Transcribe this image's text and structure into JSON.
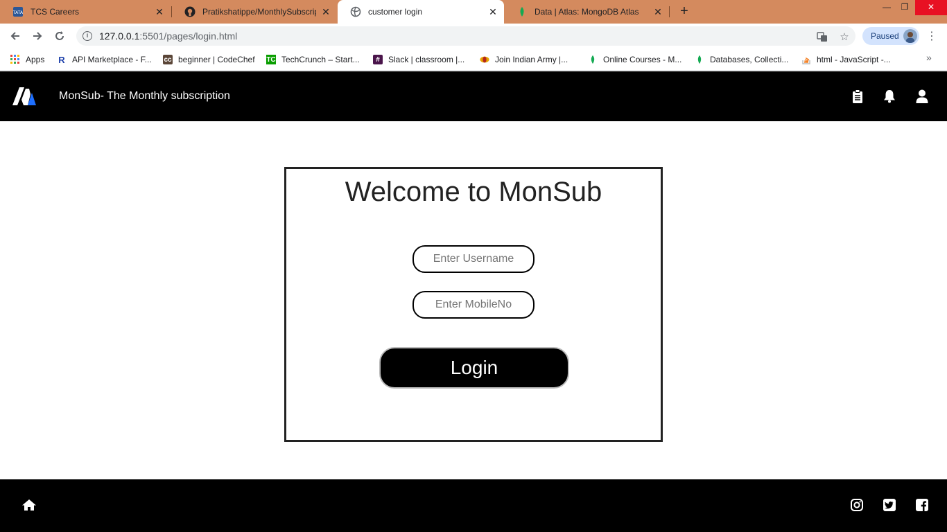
{
  "browser": {
    "tabs": [
      {
        "title": "TCS Careers",
        "favicon": "tata-icon"
      },
      {
        "title": "Pratikshatippe/MonthlySubscript",
        "favicon": "github-icon"
      },
      {
        "title": "customer login",
        "favicon": "globe-icon",
        "active": true
      },
      {
        "title": "Data | Atlas: MongoDB Atlas",
        "favicon": "mongodb-leaf-icon"
      }
    ],
    "url_host": "127.0.0.1",
    "url_path": ":5501/pages/login.html",
    "profile_label": "Paused",
    "bookmarks": [
      {
        "label": "Apps",
        "icon": "apps-grid-icon"
      },
      {
        "label": "API Marketplace - F...",
        "icon": "rapidapi-icon"
      },
      {
        "label": "beginner | CodeChef",
        "icon": "codechef-icon"
      },
      {
        "label": "TechCrunch – Start...",
        "icon": "techcrunch-icon"
      },
      {
        "label": "Slack | classroom |...",
        "icon": "slack-icon"
      },
      {
        "label": "Join Indian Army |...",
        "icon": "indian-army-icon"
      },
      {
        "label": "Online Courses - M...",
        "icon": "mongodb-leaf-icon"
      },
      {
        "label": "Databases, Collecti...",
        "icon": "mongodb-leaf-icon"
      },
      {
        "label": "html - JavaScript -...",
        "icon": "stackoverflow-icon"
      }
    ]
  },
  "site": {
    "title": "MonSub- The Monthly subscription",
    "header_icons": [
      "clipboard-icon",
      "bell-icon",
      "user-icon"
    ],
    "footer_icons": [
      "home-icon",
      "instagram-icon",
      "twitter-icon",
      "facebook-icon"
    ]
  },
  "login": {
    "heading": "Welcome to MonSub",
    "username_placeholder": "Enter Username",
    "mobile_placeholder": "Enter MobileNo",
    "button_label": "Login"
  },
  "colors": {
    "tabstrip": "#d48a5e",
    "header_bg": "#000000",
    "logo_white": "#ffffff",
    "logo_blue": "#1e6fff"
  }
}
